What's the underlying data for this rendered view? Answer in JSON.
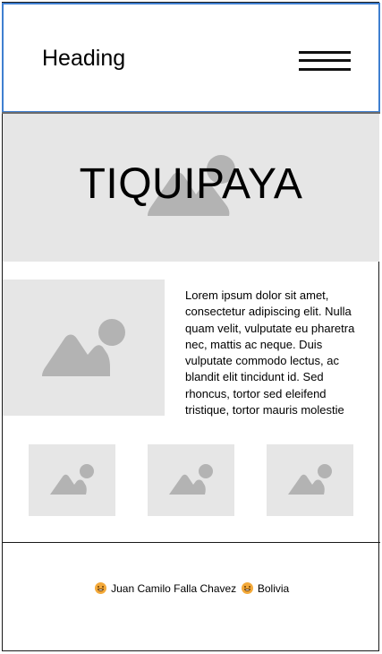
{
  "header": {
    "heading": "Heading",
    "menu_icon": "hamburger-menu-icon"
  },
  "hero": {
    "title": "TIQUIPAYA",
    "image_icon": "image-placeholder-icon"
  },
  "content": {
    "image_icon": "image-placeholder-icon",
    "paragraph": "Lorem ipsum dolor sit amet, consectetur adipiscing elit. Nulla quam velit, vulputate eu pharetra nec, mattis ac neque. Duis vulputate commodo lectus, ac blandit elit tincidunt id. Sed rhoncus, tortor sed eleifend tristique, tortor mauris molestie"
  },
  "gallery": {
    "thumbnails": [
      {
        "icon": "image-placeholder-icon"
      },
      {
        "icon": "image-placeholder-icon"
      },
      {
        "icon": "image-placeholder-icon"
      }
    ]
  },
  "footer": {
    "author": "Juan Camilo Falla Chavez",
    "country": "Bolivia",
    "emoji_icon": "smiling-face-icon"
  },
  "colors": {
    "header_border": "#3f7fd0",
    "placeholder_bg": "#e6e6e6",
    "placeholder_icon": "#b3b3b3"
  }
}
